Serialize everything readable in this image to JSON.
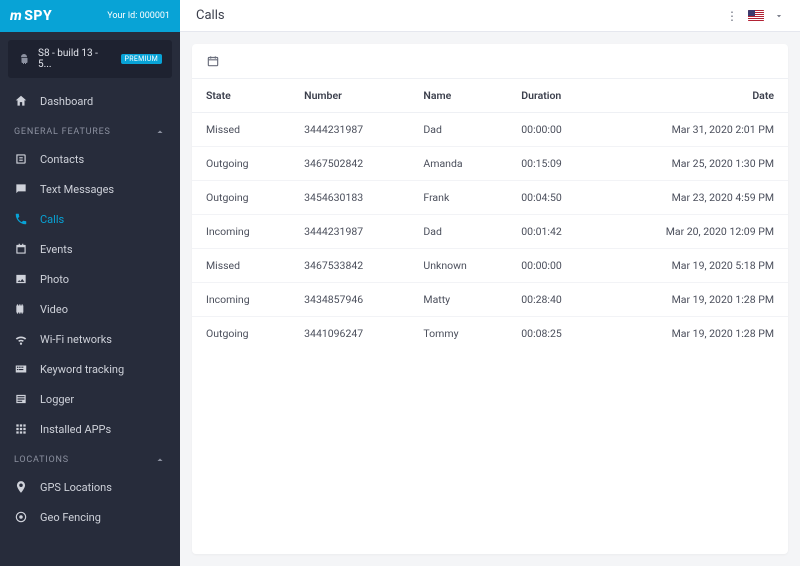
{
  "brand": {
    "logo_m": "m",
    "logo_spy": "SPY",
    "id_label": "Your Id:",
    "id_value": "000001"
  },
  "device": {
    "name": "S8 - build 13 - 5...",
    "badge": "PREMIUM"
  },
  "dash": {
    "label": "Dashboard"
  },
  "sections": {
    "general": {
      "title": "GENERAL FEATURES"
    },
    "locations": {
      "title": "LOCATIONS"
    }
  },
  "nav": {
    "contacts": "Contacts",
    "texts": "Text Messages",
    "calls": "Calls",
    "events": "Events",
    "photo": "Photo",
    "video": "Video",
    "wifi": "Wi-Fi networks",
    "keyword": "Keyword tracking",
    "logger": "Logger",
    "apps": "Installed APPs",
    "gps": "GPS Locations",
    "geo": "Geo Fencing"
  },
  "page": {
    "title": "Calls"
  },
  "table": {
    "headers": {
      "state": "State",
      "number": "Number",
      "name": "Name",
      "duration": "Duration",
      "date": "Date"
    },
    "rows": [
      {
        "state": "Missed",
        "number": "3444231987",
        "name": "Dad",
        "duration": "00:00:00",
        "date": "Mar 31, 2020 2:01 PM"
      },
      {
        "state": "Outgoing",
        "number": "3467502842",
        "name": "Amanda",
        "duration": "00:15:09",
        "date": "Mar 25, 2020 1:30 PM"
      },
      {
        "state": "Outgoing",
        "number": "3454630183",
        "name": "Frank",
        "duration": "00:04:50",
        "date": "Mar 23, 2020 4:59 PM"
      },
      {
        "state": "Incoming",
        "number": "3444231987",
        "name": "Dad",
        "duration": "00:01:42",
        "date": "Mar 20, 2020 12:09 PM"
      },
      {
        "state": "Missed",
        "number": "3467533842",
        "name": "Unknown",
        "duration": "00:00:00",
        "date": "Mar 19, 2020 5:18 PM"
      },
      {
        "state": "Incoming",
        "number": "3434857946",
        "name": "Matty",
        "duration": "00:28:40",
        "date": "Mar 19, 2020 1:28 PM"
      },
      {
        "state": "Outgoing",
        "number": "3441096247",
        "name": "Tommy",
        "duration": "00:08:25",
        "date": "Mar 19, 2020 1:28 PM"
      }
    ]
  }
}
